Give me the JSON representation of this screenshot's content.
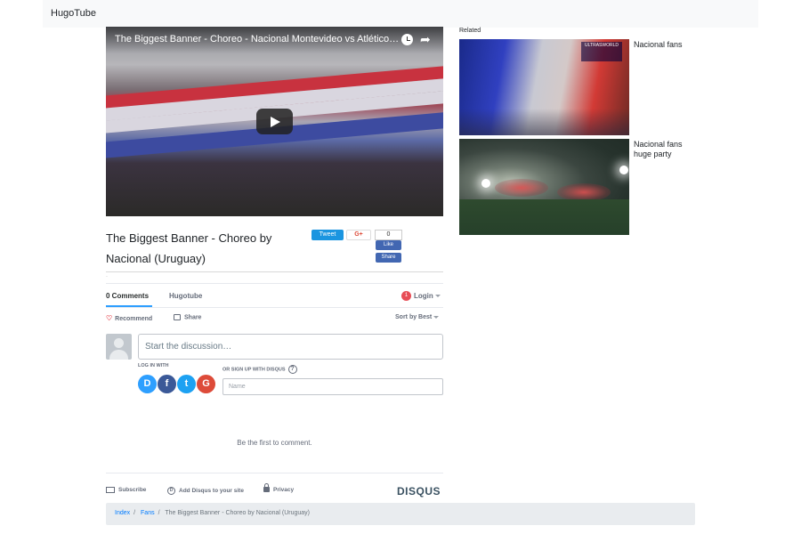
{
  "app": {
    "brand": "HugoTube"
  },
  "video": {
    "title": "The Biggest Banner - Choreo - Nacional Montevideo vs Atlético M..."
  },
  "post": {
    "title": "The Biggest Banner - Choreo by Nacional (Uruguay)"
  },
  "social": {
    "tweet": "Tweet",
    "gplus": "G+",
    "fb_count": "0",
    "fb_like": "Like",
    "fb_share": "Share"
  },
  "separator_dot": "·",
  "disqus": {
    "tab_comments": "0 Comments",
    "tab_site": "Hugotube",
    "notification_count": "1",
    "login": "Login",
    "recommend": "Recommend",
    "share": "Share",
    "sort": "Sort by Best",
    "input_placeholder": "Start the discussion…",
    "login_with": "LOG IN WITH",
    "signup": "OR SIGN UP WITH DISQUS",
    "help": "?",
    "name_placeholder": "Name",
    "providers": [
      {
        "label": "D",
        "icon": "disqus-icon",
        "color": "#2e9fff"
      },
      {
        "label": "f",
        "icon": "facebook-icon",
        "color": "#3b5998"
      },
      {
        "label": "t",
        "icon": "twitter-icon",
        "color": "#1da1f2"
      },
      {
        "label": "G",
        "icon": "google-icon",
        "color": "#dd4b39"
      }
    ],
    "empty_message": "Be the first to comment.",
    "footer": {
      "subscribe": "Subscribe",
      "add_disqus": "Add Disqus to your site",
      "privacy": "Privacy",
      "logo": "DISQUS"
    }
  },
  "breadcrumb": {
    "items": [
      "Index",
      "Fans"
    ],
    "current": "The Biggest Banner - Choreo by Nacional (Uruguay)",
    "separator": "/"
  },
  "related": {
    "label": "Related",
    "items": [
      {
        "title": "Nacional fans",
        "badge": "ULTRASWORLD"
      },
      {
        "title": "Nacional fans huge party"
      }
    ]
  },
  "colors": {
    "accent": "#2e9fff",
    "link": "#007bff",
    "danger": "#e74d56"
  }
}
